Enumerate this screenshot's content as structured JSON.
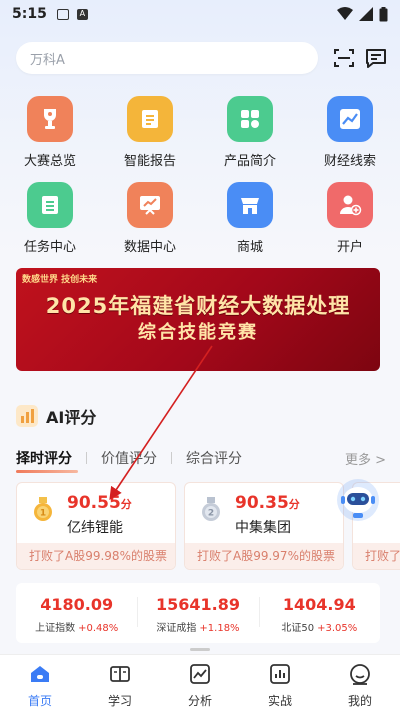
{
  "status_bar": {
    "time": "5:15",
    "a_badge": "A"
  },
  "search": {
    "placeholder": "万科A"
  },
  "icons_top": [
    "scan-icon",
    "message-icon"
  ],
  "grid": [
    {
      "label": "大赛总览",
      "icon": "trophy-icon",
      "color": "#f0825a"
    },
    {
      "label": "智能报告",
      "icon": "report-icon",
      "color": "#f4b53a"
    },
    {
      "label": "产品简介",
      "icon": "apps-icon",
      "color": "#4ccb8f"
    },
    {
      "label": "财经线索",
      "icon": "chart-up-icon",
      "color": "#4a8df5"
    },
    {
      "label": "任务中心",
      "icon": "list-icon",
      "color": "#4ccb8f"
    },
    {
      "label": "数据中心",
      "icon": "board-icon",
      "color": "#f0825a"
    },
    {
      "label": "商城",
      "icon": "shop-icon",
      "color": "#4a8df5"
    },
    {
      "label": "开户",
      "icon": "add-user-icon",
      "color": "#f06a6a"
    }
  ],
  "banner": {
    "tag": "数感世界 技创未来",
    "title_line1": "2025年福建省财经大数据处理",
    "title_line2": "综合技能竞赛"
  },
  "ai_section": {
    "title": "AI评分",
    "tabs": [
      "择时评分",
      "价值评分",
      "综合评分"
    ],
    "more": "更多 >"
  },
  "score_cards": [
    {
      "score": "90.55",
      "unit": "分",
      "name": "亿纬锂能",
      "beat": "打败了A股99.98%的股票",
      "medal": "gold"
    },
    {
      "score": "90.35",
      "unit": "分",
      "name": "中集集团",
      "beat": "打败了A股99.97%的股票",
      "medal": "silver"
    },
    {
      "score": "",
      "unit": "",
      "name": "",
      "beat": "打败了",
      "medal": ""
    }
  ],
  "indices": [
    {
      "value": "4180.09",
      "name": "上证指数",
      "change": "+0.48%"
    },
    {
      "value": "15641.89",
      "name": "深证成指",
      "change": "+1.18%"
    },
    {
      "value": "1404.94",
      "name": "北证50",
      "change": "+3.05%"
    }
  ],
  "nav": [
    {
      "label": "首页",
      "active": true
    },
    {
      "label": "学习",
      "active": false
    },
    {
      "label": "分析",
      "active": false
    },
    {
      "label": "实战",
      "active": false
    },
    {
      "label": "我的",
      "active": false
    }
  ],
  "colors": {
    "accent": "#3b7cf5",
    "up": "#e8342a"
  }
}
